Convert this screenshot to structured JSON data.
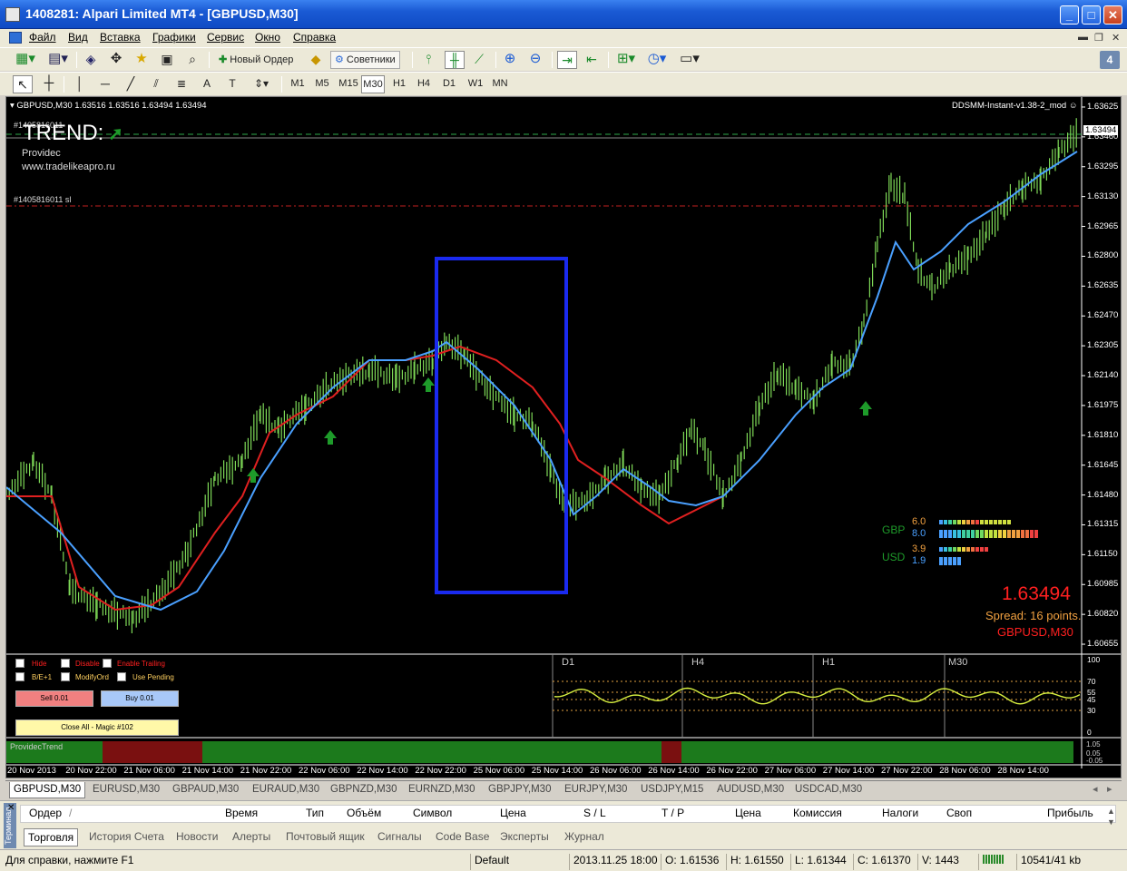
{
  "window": {
    "title": "1408281: Alpari Limited MT4 - [GBPUSD,M30]"
  },
  "menu": [
    "Файл",
    "Вид",
    "Вставка",
    "Графики",
    "Сервис",
    "Окно",
    "Справка"
  ],
  "toolbar": {
    "new_order": "Новый Ордер",
    "advisors": "Советники",
    "timeframes": [
      "M1",
      "M5",
      "M15",
      "M30",
      "H1",
      "H4",
      "D1",
      "W1",
      "MN"
    ],
    "active_timeframe": "M30",
    "badge": "4"
  },
  "chart": {
    "header": "GBPUSD,M30  1.63516 1.63516 1.63494 1.63494",
    "ea_name": "DDSMM-Instant-v1.38-2_mod",
    "trend_label": "TREND:",
    "provider": "Providec",
    "website": "www.tradelikeapro.ru",
    "order_label_top": "#1405816011",
    "order_label_sl": "#1405816011 sl",
    "price_levels": [
      "1.63625",
      "1.63460",
      "1.63295",
      "1.63130",
      "1.62965",
      "1.62800",
      "1.62635",
      "1.62470",
      "1.62305",
      "1.62140",
      "1.61975",
      "1.61810",
      "1.61645",
      "1.61480",
      "1.61315",
      "1.61150",
      "1.60985",
      "1.60820",
      "1.60655"
    ],
    "current_price_marker": "1.63494",
    "strength": {
      "gbp_label": "GBP",
      "gbp_values": [
        "6.0",
        "8.0"
      ],
      "usd_label": "USD",
      "usd_values": [
        "3.9",
        "1.9"
      ]
    },
    "big_price": "1.63494",
    "spread": "Spread: 16 points.",
    "symbol_tf": "GBPUSD,M30",
    "panel": {
      "hide": "Hide",
      "disable": "Disable",
      "enable_trailing": "Enable Trailing",
      "be": "B/E+1",
      "modify": "ModifyOrd",
      "pending": "Use Pending",
      "sell": "Sell 0.01",
      "buy": "Buy 0.01",
      "close_all": "Close All - Magic #102"
    },
    "osc_tf_labels": [
      "D1",
      "H4",
      "H1",
      "M30"
    ],
    "osc_levels": [
      "100",
      "70",
      "55",
      "45",
      "30",
      "0"
    ],
    "trend_indicator": "ProvidecTrend",
    "trend_levels": [
      "1.05",
      "0.05",
      "-0.05"
    ],
    "time_labels": [
      "20 Nov 2013",
      "20 Nov 22:00",
      "21 Nov 06:00",
      "21 Nov 14:00",
      "21 Nov 22:00",
      "22 Nov 06:00",
      "22 Nov 14:00",
      "22 Nov 22:00",
      "25 Nov 06:00",
      "25 Nov 14:00",
      "26 Nov 06:00",
      "26 Nov 14:00",
      "26 Nov 22:00",
      "27 Nov 06:00",
      "27 Nov 14:00",
      "27 Nov 22:00",
      "28 Nov 06:00",
      "28 Nov 14:00"
    ]
  },
  "symbol_tabs": [
    "GBPUSD,M30",
    "EURUSD,M30",
    "GBPAUD,M30",
    "EURAUD,M30",
    "GBPNZD,M30",
    "EURNZD,M30",
    "GBPJPY,M30",
    "EURJPY,M30",
    "USDJPY,M15",
    "AUDUSD,M30",
    "USDCAD,M30"
  ],
  "terminal": {
    "columns": [
      "Ордер",
      "/",
      "Время",
      "Тип",
      "Объём",
      "Символ",
      "Цена",
      "S / L",
      "T / P",
      "Цена",
      "Комиссия",
      "Налоги",
      "Своп",
      "Прибыль"
    ],
    "tabs": [
      "Торговля",
      "История Счета",
      "Новости",
      "Алерты",
      "Почтовый ящик",
      "Сигналы",
      "Code Base",
      "Эксперты",
      "Журнал"
    ],
    "side_label": "Терминал"
  },
  "status": {
    "help": "Для справки, нажмите F1",
    "profile": "Default",
    "time": "2013.11.25 18:00",
    "open": "O: 1.61536",
    "high": "H: 1.61550",
    "low": "L: 1.61344",
    "close": "C: 1.61370",
    "volume": "V: 1443",
    "traffic": "10541/41 kb"
  }
}
